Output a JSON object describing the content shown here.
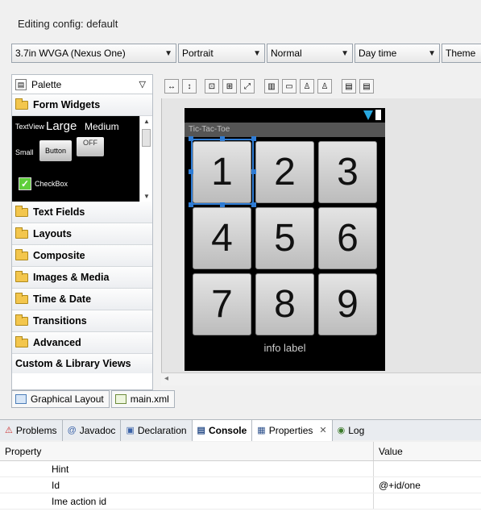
{
  "config": {
    "title": "Editing config: default"
  },
  "toolbar": {
    "device": "3.7in WVGA (Nexus One)",
    "orientation": "Portrait",
    "mode": "Normal",
    "time": "Day time",
    "theme": "Theme"
  },
  "palette": {
    "title": "Palette",
    "categories": {
      "form_widgets": "Form Widgets",
      "text_fields": "Text Fields",
      "layouts": "Layouts",
      "composite": "Composite",
      "images_media": "Images & Media",
      "time_date": "Time & Date",
      "transitions": "Transitions",
      "advanced": "Advanced",
      "custom": "Custom & Library Views"
    },
    "preview": {
      "textview": "TextView",
      "large": "Large",
      "medium": "Medium",
      "small": "Small",
      "button": "Button",
      "toggle": "OFF",
      "checkbox": "CheckBox"
    }
  },
  "device": {
    "app_title": "Tic-Tac-Toe",
    "cells": [
      "1",
      "2",
      "3",
      "4",
      "5",
      "6",
      "7",
      "8",
      "9"
    ],
    "info_label": "info label"
  },
  "editor_tabs": {
    "graphical": "Graphical Layout",
    "xml": "main.xml"
  },
  "views": {
    "problems": "Problems",
    "javadoc": "Javadoc",
    "declaration": "Declaration",
    "console": "Console",
    "properties": "Properties",
    "log": "Log"
  },
  "properties": {
    "col_property": "Property",
    "col_value": "Value",
    "rows": [
      {
        "name": "Hint",
        "value": ""
      },
      {
        "name": "Id",
        "value": "@+id/one"
      },
      {
        "name": "Ime action id",
        "value": ""
      }
    ]
  }
}
